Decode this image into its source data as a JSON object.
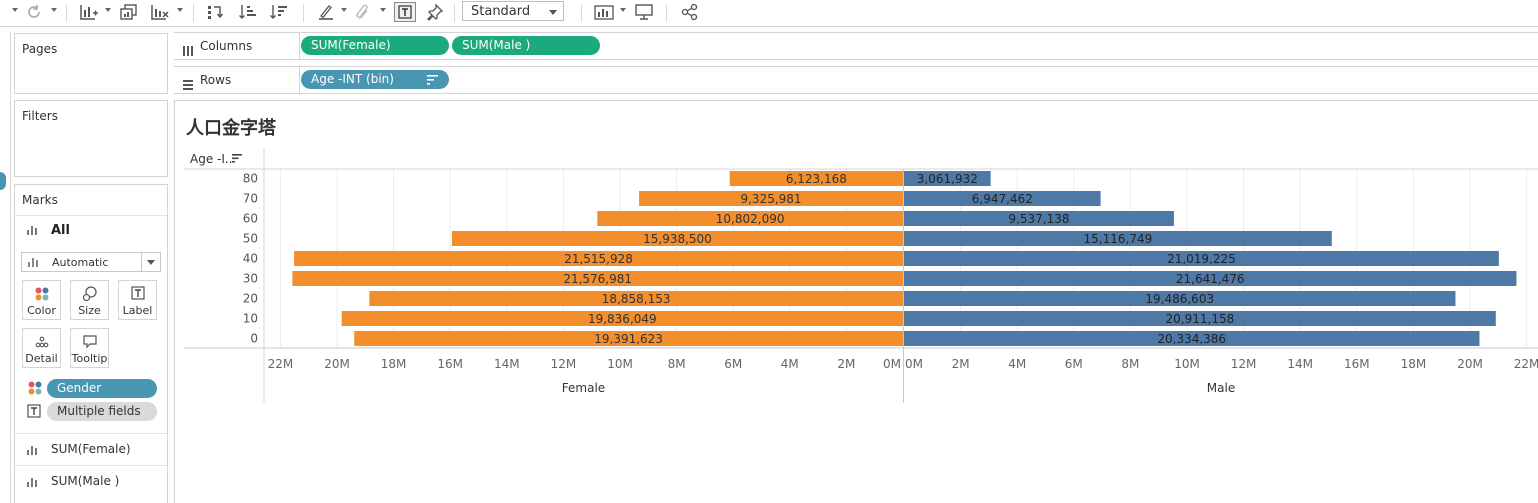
{
  "toolbar": {
    "mark_type_select": "Standard"
  },
  "cards": {
    "pages_title": "Pages",
    "filters_title": "Filters",
    "marks_title": "Marks",
    "marks_all": "All",
    "mark_type": "Automatic",
    "buttons": {
      "color": "Color",
      "size": "Size",
      "label": "Label",
      "detail": "Detail",
      "tooltip": "Tooltip"
    },
    "pill_gender": "Gender",
    "pill_multiple": "Multiple fields",
    "measure_female": "SUM(Female)",
    "measure_male": "SUM(Male )"
  },
  "shelves": {
    "columns_label": "Columns",
    "rows_label": "Rows",
    "col_pill_1": "SUM(Female)",
    "col_pill_2": "SUM(Male )",
    "row_pill_1": "Age -INT (bin)"
  },
  "colors": {
    "female": "#f28e2b",
    "male": "#4e79a7",
    "pill_green": "#1aaa7d",
    "pill_blue": "#4996b2"
  },
  "chart_data": {
    "type": "bar",
    "title": "人口金字塔",
    "row_header": "Age -I..",
    "categories": [
      "80",
      "70",
      "60",
      "50",
      "40",
      "30",
      "20",
      "10",
      "0"
    ],
    "series": [
      {
        "name": "Female",
        "values": [
          6123168,
          9325981,
          10802090,
          15938500,
          21515928,
          21576981,
          18858153,
          19836049,
          19391623
        ],
        "labels": [
          "6,123,168",
          "9,325,981",
          "10,802,090",
          "15,938,500",
          "21,515,928",
          "21,576,981",
          "18,858,153",
          "19,836,049",
          "19,391,623"
        ]
      },
      {
        "name": "Male",
        "values": [
          3061932,
          6947462,
          9537138,
          15116749,
          21019225,
          21641476,
          19486603,
          20911158,
          20334386
        ],
        "labels": [
          "3,061,932",
          "6,947,462",
          "9,537,138",
          "15,116,749",
          "21,019,225",
          "21,641,476",
          "19,486,603",
          "20,911,158",
          "20,334,386"
        ]
      }
    ],
    "female_ticks": [
      "22M",
      "20M",
      "18M",
      "16M",
      "14M",
      "12M",
      "10M",
      "8M",
      "6M",
      "4M",
      "2M",
      "0M"
    ],
    "male_ticks": [
      "0M",
      "2M",
      "4M",
      "6M",
      "8M",
      "10M",
      "12M",
      "14M",
      "16M",
      "18M",
      "20M",
      "22M"
    ],
    "xlim": [
      0,
      22000000
    ],
    "female_axis_title": "Female",
    "male_axis_title": "Male",
    "grid": true
  }
}
